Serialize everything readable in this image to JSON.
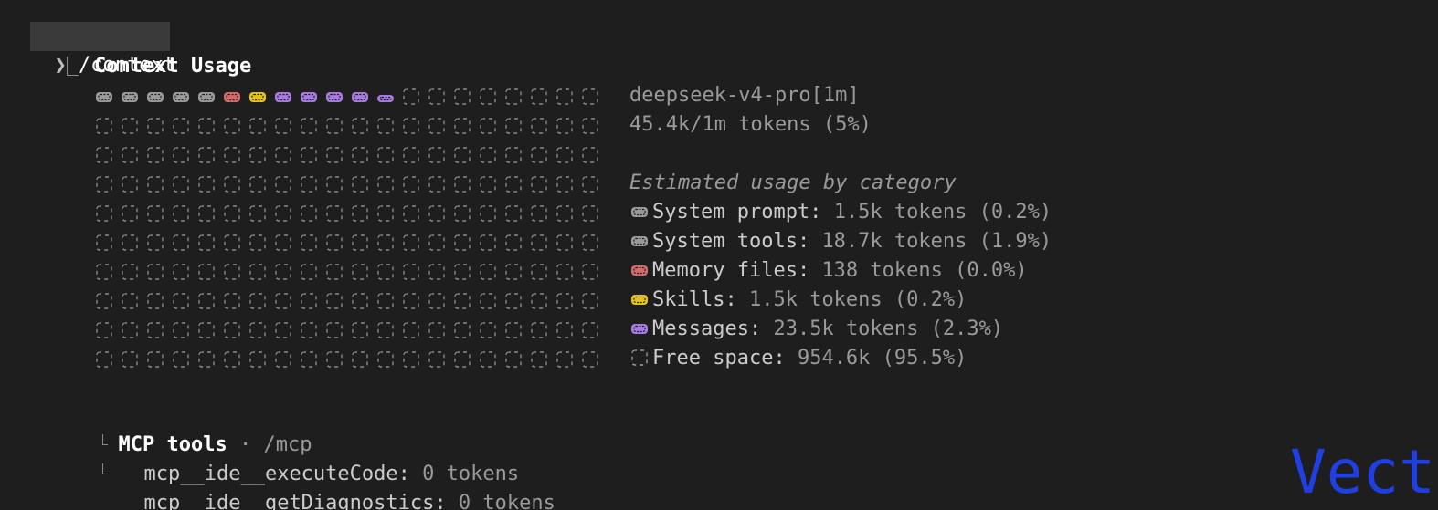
{
  "command": {
    "prompt_glyph": "❯",
    "text": "/context"
  },
  "header": {
    "title": "Context Usage"
  },
  "model": {
    "name": "deepseek-v4-pro[1m]",
    "tokens_summary": "45.4k/1m tokens (5%)"
  },
  "categories": {
    "heading": "Estimated usage by category",
    "items": [
      {
        "icon": "filled-block-icon",
        "color": "#9a9a9a",
        "label": "System prompt:",
        "value": "1.5k tokens (0.2%)"
      },
      {
        "icon": "filled-block-icon",
        "color": "#9a9a9a",
        "label": "System tools:",
        "value": "18.7k tokens (1.9%)"
      },
      {
        "icon": "filled-block-icon",
        "color": "#d46a6a",
        "label": "Memory files:",
        "value": "138 tokens (0.0%)"
      },
      {
        "icon": "filled-block-icon",
        "color": "#e8c21a",
        "label": "Skills:",
        "value": "1.5k tokens (0.2%)"
      },
      {
        "icon": "filled-block-icon",
        "color": "#a77be0",
        "label": "Messages:",
        "value": "23.5k tokens (2.3%)"
      },
      {
        "icon": "empty-block-icon",
        "color": "#9a9a9a",
        "label": "Free space:",
        "value": "954.6k (95.5%)"
      }
    ]
  },
  "grid": {
    "columns": 20,
    "rows": 10,
    "first_row_colors": [
      "#9a9a9a",
      "#9a9a9a",
      "#9a9a9a",
      "#9a9a9a",
      "#9a9a9a",
      "#d46a6a",
      "#e8c21a",
      "#a77be0",
      "#a77be0",
      "#a77be0",
      "#a77be0",
      "#a77be0"
    ],
    "first_row_small_last": true,
    "empty_color": "#8a8a8a"
  },
  "mcp": {
    "title": "MCP tools",
    "separator": "·",
    "link": "/mcp",
    "tools": [
      {
        "name": "mcp__ide__executeCode:",
        "value": "0 tokens"
      },
      {
        "name": "mcp__ide__getDiagnostics:",
        "value": "0 tokens"
      }
    ]
  },
  "watermark": {
    "text": "Vect"
  }
}
